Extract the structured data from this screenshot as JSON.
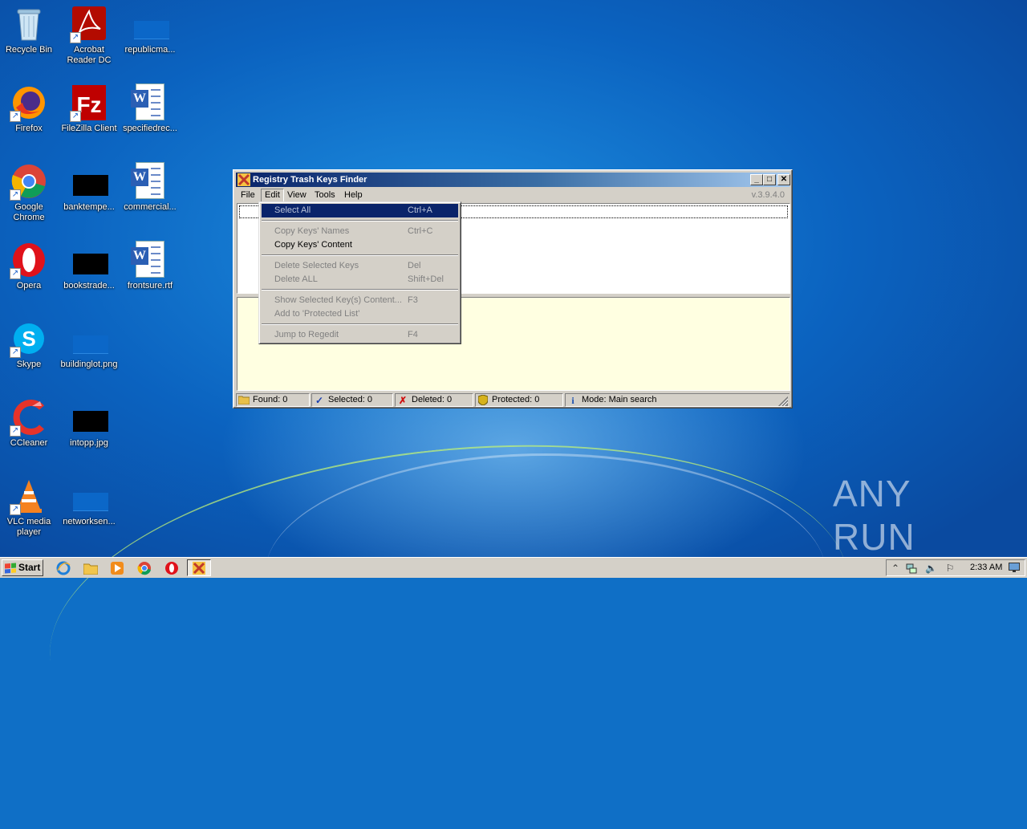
{
  "desktop": {
    "icons": [
      {
        "label": "Recycle Bin"
      },
      {
        "label": "Acrobat Reader DC"
      },
      {
        "label": "republicma..."
      },
      {
        "label": "Firefox"
      },
      {
        "label": "FileZilla Client"
      },
      {
        "label": "specifiedrec..."
      },
      {
        "label": "Google Chrome"
      },
      {
        "label": "banktempe..."
      },
      {
        "label": "commercial..."
      },
      {
        "label": "Opera"
      },
      {
        "label": "bookstrade..."
      },
      {
        "label": "frontsure.rtf"
      },
      {
        "label": "Skype"
      },
      {
        "label": "buildinglot.png"
      },
      {
        "label": "CCleaner"
      },
      {
        "label": "intopp.jpg"
      },
      {
        "label": "VLC media player"
      },
      {
        "label": "networksen..."
      }
    ],
    "watermark": "ANY RUN"
  },
  "window": {
    "title": "Registry Trash Keys Finder",
    "version": "v.3.9.4.0",
    "menu": [
      "File",
      "Edit",
      "View",
      "Tools",
      "Help"
    ],
    "active_menu": "Edit",
    "status": {
      "found": "Found: 0",
      "selected": "Selected: 0",
      "deleted": "Deleted: 0",
      "protected": "Protected: 0",
      "mode": "Mode: Main search"
    }
  },
  "edit_menu": {
    "items": [
      {
        "label": "Select All",
        "shortcut": "Ctrl+A",
        "enabled": false,
        "highlighted": true
      },
      {
        "label": "Copy Keys' Names",
        "shortcut": "Ctrl+C",
        "enabled": false
      },
      {
        "label": "Copy Keys' Content",
        "shortcut": "",
        "enabled": true
      },
      {
        "label": "Delete Selected Keys",
        "shortcut": "Del",
        "enabled": false
      },
      {
        "label": "Delete ALL",
        "shortcut": "Shift+Del",
        "enabled": false
      },
      {
        "label": "Show Selected Key(s) Content...",
        "shortcut": "F3",
        "enabled": false
      },
      {
        "label": "Add to 'Protected List'",
        "shortcut": "",
        "enabled": false
      },
      {
        "label": "Jump to Regedit",
        "shortcut": "F4",
        "enabled": false
      }
    ]
  },
  "taskbar": {
    "start_label": "Start",
    "clock": "2:33 AM"
  },
  "colors": {
    "titlebar_start": "#0a246a",
    "menu_highlight": "#0a246a",
    "info_pane": "#ffffe1",
    "desktop_blue": "#0f6fc6"
  }
}
